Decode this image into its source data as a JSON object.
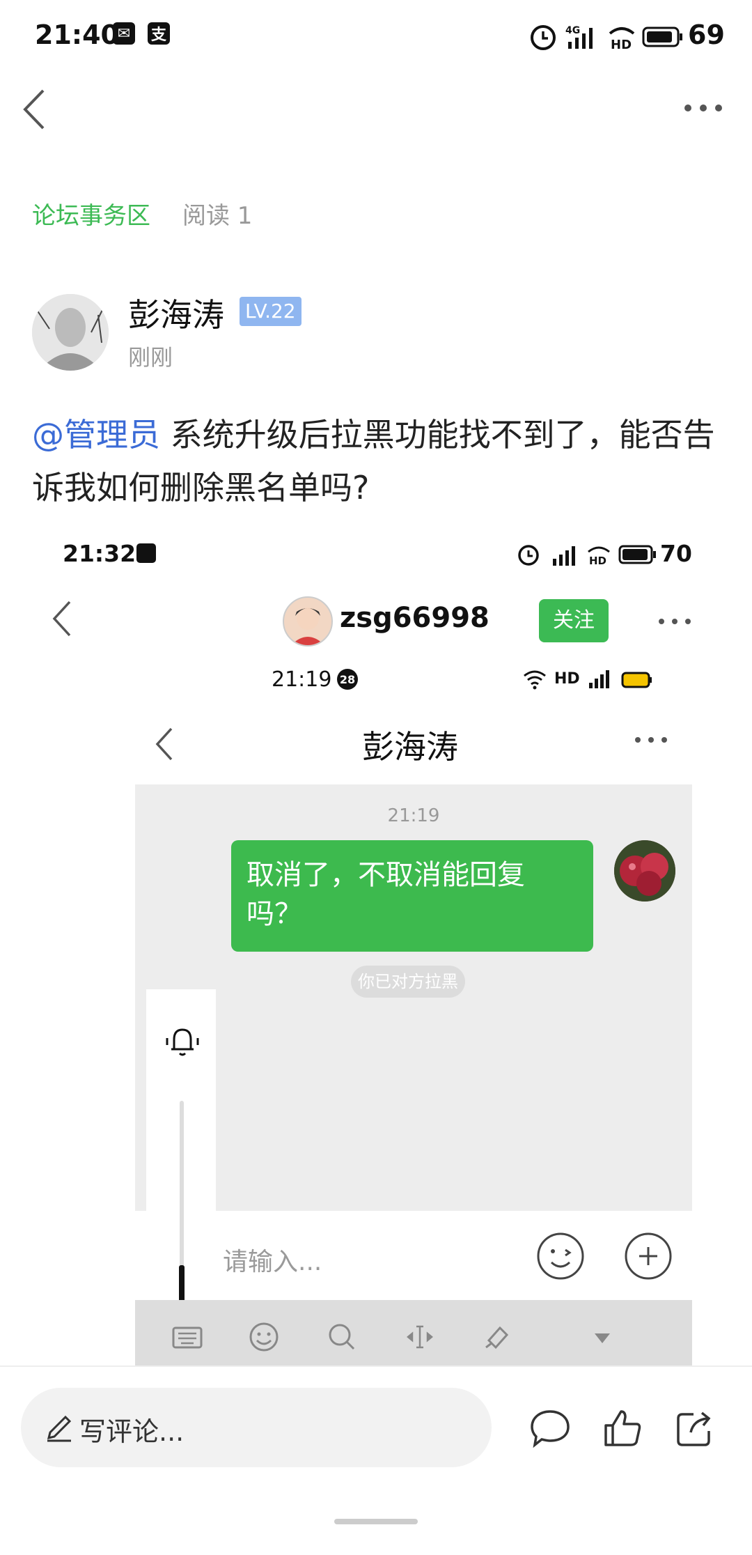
{
  "status_bar": {
    "time": "21:40",
    "battery": "69",
    "badge1": "✉",
    "badge2": "支"
  },
  "header": {
    "back": "back",
    "more": "more"
  },
  "post": {
    "section": "论坛事务区",
    "read_count": "阅读 1",
    "author": "彭海涛",
    "level": "LV.22",
    "time": "刚刚",
    "mention": "@管理员",
    "text": " 系统升级后拉黑功能找不到了，能否告诉我如何删除黑名单吗?"
  },
  "screenshot": {
    "status_time": "21:32",
    "battery": "70",
    "username": "zsg66998",
    "follow_label": "关注",
    "inner_time": "21:19",
    "inner_badge": "28",
    "chat_title": "彭海涛",
    "chat_timestamp": "21:19",
    "message": "取消了，不取消能回复吗？",
    "system_notice": "你已对方拉黑",
    "input_placeholder": "请输入..."
  },
  "bottom_bar": {
    "comment_placeholder": "写评论..."
  },
  "icons": [
    "back-icon",
    "more-icon",
    "bell-icon",
    "emoji-icon",
    "plus-icon",
    "keyboard-icon",
    "search-icon",
    "cursor-icon",
    "brush-icon",
    "down-arrow-icon",
    "pen-icon",
    "comment-icon",
    "like-icon",
    "share-icon"
  ],
  "colors": {
    "accent_green": "#3cba54",
    "mention_blue": "#3b6bd6",
    "level_badge": "#8fb6f0"
  }
}
